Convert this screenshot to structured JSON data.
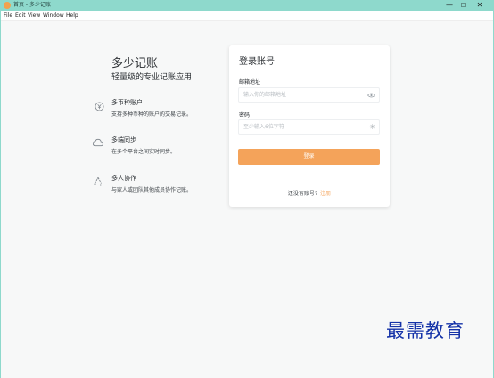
{
  "window": {
    "title": "首页 - 多少记账",
    "controls": {
      "minimize": "—",
      "maximize": "☐",
      "close": "✕"
    }
  },
  "menu": [
    "File",
    "Edit",
    "View",
    "Window",
    "Help"
  ],
  "brand": {
    "title": "多少记账",
    "subtitle": "轻量级的专业记账应用"
  },
  "features": [
    {
      "icon": "currency-icon",
      "title": "多币种账户",
      "desc": "支持多种币种的账户的交易记录。"
    },
    {
      "icon": "cloud-icon",
      "title": "多端同步",
      "desc": "在多个平台之间实时同步。"
    },
    {
      "icon": "recycle-icon",
      "title": "多人协作",
      "desc": "与家人或团队其他成员协作记账。"
    }
  ],
  "login": {
    "title": "登录账号",
    "email_label": "邮箱地址",
    "email_placeholder": "输入你的邮箱地址",
    "password_label": "密码",
    "password_placeholder": "至少输入6位字符",
    "submit": "登录",
    "no_account": "还没有账号?",
    "register": "注册"
  },
  "watermark": "最需教育",
  "colors": {
    "accent": "#f4a35a",
    "titlebar": "#8ed9cc",
    "watermark": "#1432a8"
  }
}
